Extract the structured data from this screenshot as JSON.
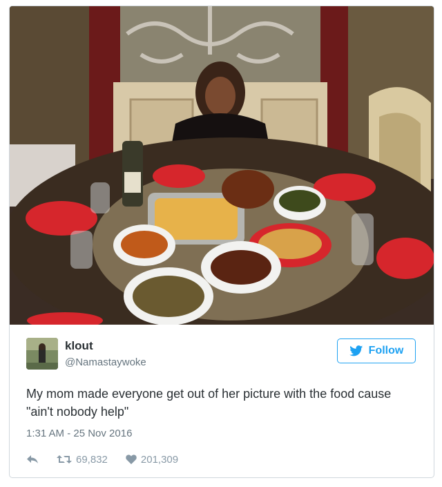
{
  "user": {
    "name": "klout",
    "handle": "@Namastaywoke"
  },
  "follow_button": {
    "label": "Follow"
  },
  "tweet": {
    "text": "My mom made everyone get out of her picture with the food cause \"ain't nobody help\"",
    "timestamp": "1:31 AM - 25 Nov 2016"
  },
  "actions": {
    "retweets": "69,832",
    "likes": "201,309"
  },
  "icons": [
    "reply-icon",
    "retweet-icon",
    "heart-icon",
    "twitter-bird-icon"
  ],
  "colors": {
    "accent": "#1da1f2",
    "text": "#292f33",
    "muted": "#66757f"
  }
}
